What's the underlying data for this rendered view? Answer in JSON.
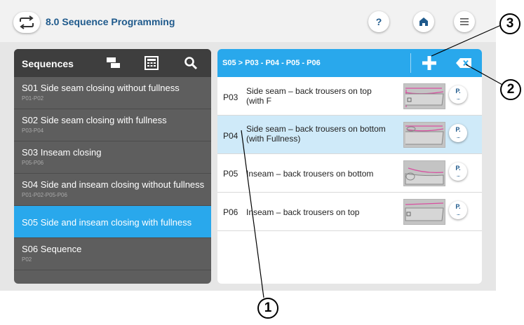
{
  "header": {
    "title": "8.0 Sequence Programming",
    "help_label": "?",
    "icons": [
      "repeat-icon",
      "help-icon",
      "home-icon",
      "menu-icon"
    ]
  },
  "sequences_panel": {
    "title": "Sequences",
    "icons": [
      "copy-icon",
      "keypad-icon",
      "search-icon"
    ],
    "items": [
      {
        "title": "S01  Side seam closing without fullness",
        "sub": "P01-P02"
      },
      {
        "title": "S02  Side seam closing with fullness",
        "sub": "P03-P04"
      },
      {
        "title": "S03  Inseam closing",
        "sub": "P05-P06"
      },
      {
        "title": "S04  Side and inseam closing without fullness",
        "sub": "P01-P02-P05-P06"
      },
      {
        "title": "S05  Side and inseam closing with fullness",
        "sub": ""
      },
      {
        "title": "S06  Sequence",
        "sub": "P02"
      }
    ],
    "selected_index": 4
  },
  "programs_panel": {
    "breadcrumb": "S05 > P03 - P04 - P05 - P06",
    "icons": [
      "add-icon",
      "delete-icon"
    ],
    "button_label": "P.",
    "button_dots": "...",
    "items": [
      {
        "code": "P03",
        "line1": "Side seam – back trousers on top",
        "line2": "(with F"
      },
      {
        "code": "P04",
        "line1": "Side seam – back trousers on bottom",
        "line2": "(with Fullness)"
      },
      {
        "code": "P05",
        "line1": "Inseam – back trousers on bottom",
        "line2": ""
      },
      {
        "code": "P06",
        "line1": "Inseam – back trousers on top",
        "line2": ""
      }
    ],
    "selected_index": 1
  },
  "callouts": {
    "one": "1",
    "two": "2",
    "three": "3"
  },
  "colors": {
    "accent": "#29a8ec",
    "panel_dark": "#5e5e5e",
    "header_dark": "#3e3e3e",
    "brand_blue": "#1f5a8c"
  }
}
